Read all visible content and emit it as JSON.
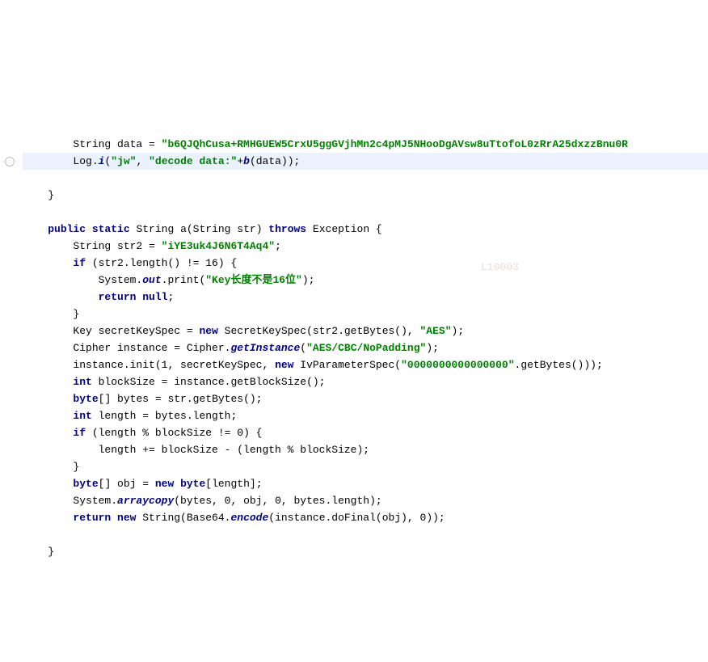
{
  "code": {
    "indent1": "    ",
    "indent2": "        ",
    "indent3": "            ",
    "l1_a": "String data = ",
    "l1_str": "\"b6QJQhCusa+RMHGUEW5CrxU5ggGVjhMn2c4pMJ5NHooDgAVsw8uTtofoL0zRrA25dxzzBnu0R",
    "l2_a": "Log.",
    "l2_i": "i",
    "l2_b": "(",
    "l2_s1": "\"jw\"",
    "l2_c": ", ",
    "l2_s2": "\"decode data:\"",
    "l2_d": "+",
    "l2_be": "b",
    "l2_e": "(data));",
    "l4": "}",
    "l6_a": "public static",
    "l6_b": " String ",
    "l6_m": "a",
    "l6_c": "(String str) ",
    "l6_th": "throws",
    "l6_d": " Exception {",
    "l7_a": "String str2 = ",
    "l7_s": "\"iYE3uk4J6N6T4Aq4\"",
    "l7_b": ";",
    "l8_if": "if",
    "l8_a": " (str2.length() != 16) {",
    "l9_a": "System.",
    "l9_out": "out",
    "l9_b": ".print(",
    "l9_s": "\"Key长度不是16位\"",
    "l9_c": ");",
    "l10_a": "return null",
    "l10_b": ";",
    "l11": "}",
    "l12_a": "Key secretKeySpec = ",
    "l12_new": "new",
    "l12_b": " SecretKeySpec(str2.getBytes(), ",
    "l12_s": "\"AES\"",
    "l12_c": ");",
    "l13_a": "Cipher instance = Cipher.",
    "l13_gi": "getInstance",
    "l13_b": "(",
    "l13_s": "\"AES/CBC/NoPadding\"",
    "l13_c": ");",
    "l14_a": "instance.init(1, secretKeySpec, ",
    "l14_new": "new",
    "l14_b": " IvParameterSpec(",
    "l14_s": "\"0000000000000000\"",
    "l14_c": ".getBytes()));",
    "l15_int": "int",
    "l15_a": " blockSize = instance.getBlockSize();",
    "l16_byte": "byte",
    "l16_a": "[] bytes = str.getBytes();",
    "l17_int": "int",
    "l17_a": " length = bytes.length;",
    "l18_if": "if",
    "l18_a": " (length % blockSize != 0) {",
    "l19": "length += blockSize - (length % blockSize);",
    "l20": "}",
    "l21_byte": "byte",
    "l21_a": "[] obj = ",
    "l21_new": "new byte",
    "l21_b": "[length];",
    "l22_a": "System.",
    "l22_ac": "arraycopy",
    "l22_b": "(bytes, 0, obj, 0, bytes.length);",
    "l23_ret": "return new",
    "l23_a": " String(Base64.",
    "l23_enc": "encode",
    "l23_b": "(instance.doFinal(obj), 0));",
    "l25": "}"
  },
  "watermark": "L10003"
}
